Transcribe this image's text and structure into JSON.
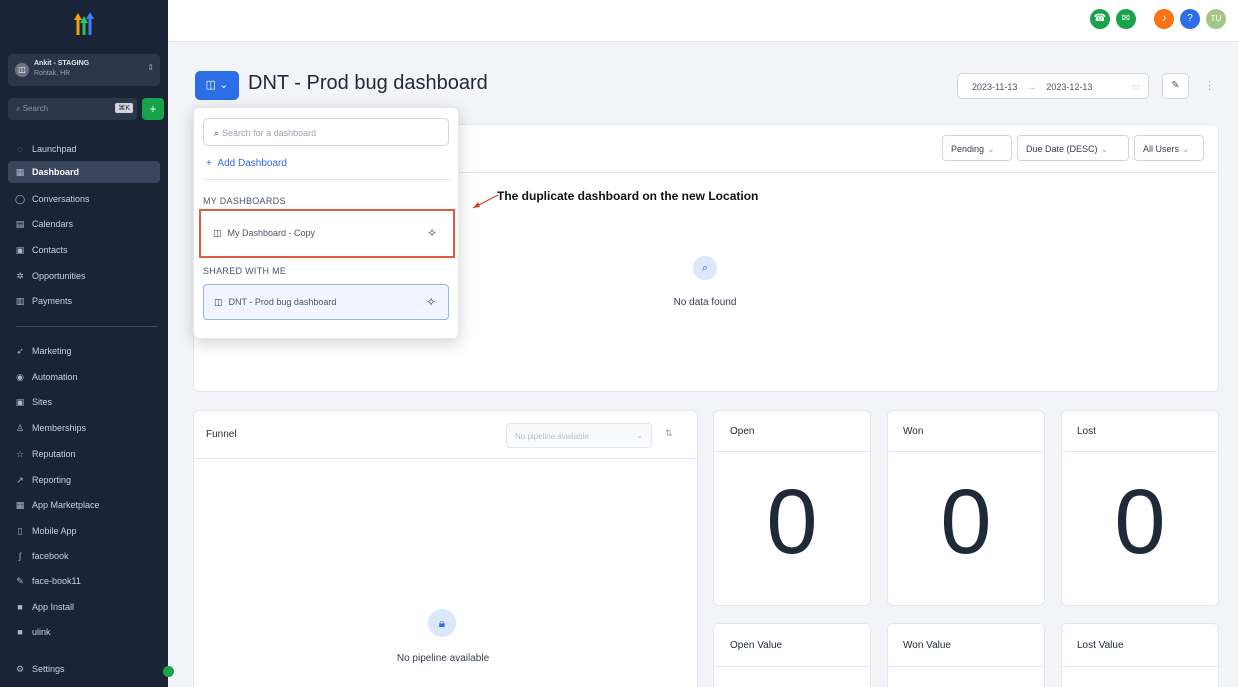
{
  "sidebar": {
    "account_name": "Ankit - STAGING",
    "account_location": "Rohtak, HR",
    "search_placeholder": "Search",
    "search_shortcut": "⌘K",
    "items": [
      {
        "label": "Launchpad",
        "icon": "rocket-icon"
      },
      {
        "label": "Dashboard",
        "icon": "grid-icon",
        "active": true
      },
      {
        "label": "Conversations",
        "icon": "chat-icon"
      },
      {
        "label": "Calendars",
        "icon": "calendar-icon"
      },
      {
        "label": "Contacts",
        "icon": "contacts-icon"
      },
      {
        "label": "Opportunities",
        "icon": "opportunities-icon"
      },
      {
        "label": "Payments",
        "icon": "payments-icon"
      },
      {
        "label": "Marketing",
        "icon": "send-icon"
      },
      {
        "label": "Automation",
        "icon": "automation-icon"
      },
      {
        "label": "Sites",
        "icon": "sites-icon"
      },
      {
        "label": "Memberships",
        "icon": "memberships-icon"
      },
      {
        "label": "Reputation",
        "icon": "star-icon"
      },
      {
        "label": "Reporting",
        "icon": "chart-icon"
      },
      {
        "label": "App Marketplace",
        "icon": "apps-icon"
      },
      {
        "label": "Mobile App",
        "icon": "mobile-icon"
      },
      {
        "label": "facebook",
        "icon": "facebook-icon"
      },
      {
        "label": "face-book11",
        "icon": "brush-icon"
      },
      {
        "label": "App Install",
        "icon": "app-install-icon"
      },
      {
        "label": "ulink",
        "icon": "link-icon"
      },
      {
        "label": "Settings",
        "icon": "gear-icon"
      }
    ]
  },
  "topbar": {
    "user_initials": "TU",
    "help": "?"
  },
  "header": {
    "title": "DNT - Prod bug dashboard",
    "date_from": "2023-11-13",
    "date_to": "2023-12-13"
  },
  "dropdown": {
    "search_placeholder": "Search for a dashboard",
    "add_label": "Add Dashboard",
    "my_header": "MY DASHBOARDS",
    "my_items": [
      "My Dashboard - Copy"
    ],
    "shared_header": "SHARED WITH ME",
    "shared_items": [
      "DNT - Prod bug dashboard"
    ]
  },
  "filters": {
    "status": "Pending",
    "sort": "Due Date (DESC)",
    "users": "All Users"
  },
  "annotation": "The duplicate dashboard on the new Location",
  "tasks_card": {
    "empty_text": "No data found"
  },
  "funnel": {
    "title": "Funnel",
    "pipeline_placeholder": "No pipeline available",
    "empty_text": "No pipeline available"
  },
  "stats": [
    {
      "title": "Open",
      "value": "0"
    },
    {
      "title": "Won",
      "value": "0"
    },
    {
      "title": "Lost",
      "value": "0"
    }
  ],
  "values": [
    {
      "title": "Open Value"
    },
    {
      "title": "Won Value"
    },
    {
      "title": "Lost Value"
    }
  ]
}
